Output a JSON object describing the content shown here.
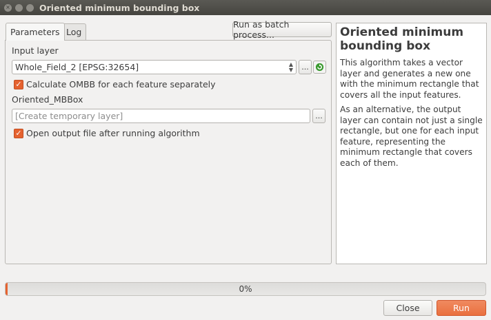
{
  "window": {
    "title": "Oriented minimum bounding box",
    "close_glyph": "×",
    "minimize_glyph": "",
    "maximize_glyph": ""
  },
  "tabs": [
    {
      "label": "Parameters",
      "active": true
    },
    {
      "label": "Log",
      "active": false
    }
  ],
  "toolbar": {
    "batch_label": "Run as batch process..."
  },
  "params": {
    "input_layer_label": "Input layer",
    "input_layer_value": "Whole_Field_2 [EPSG:32654]",
    "browse_label": "...",
    "calc_checkbox_label": "Calculate OMBB for each feature separately",
    "calc_checked": true,
    "output_label": "Oriented_MBBox",
    "output_placeholder": "[Create temporary layer]",
    "output_browse_label": "...",
    "open_checkbox_label": "Open output file after running algorithm",
    "open_checked": true
  },
  "help": {
    "title": "Oriented minimum bounding box",
    "paragraphs": [
      "This algorithm takes a vector layer and generates a new one with the minimum rectangle that covers all the input features.",
      "As an alternative, the output layer can contain not just a single rectangle, but one for each input feature, representing the minimum rectangle that covers each of them."
    ]
  },
  "progress": {
    "text": "0%",
    "fraction": 0.004
  },
  "footer": {
    "close_label": "Close",
    "run_label": "Run"
  },
  "icons": {
    "refresh": "refresh-icon",
    "combo": "spin-arrows-icon",
    "check": "checkmark-icon"
  },
  "colors": {
    "accent": "#e5622f",
    "refresh_green": "#3a9a2f"
  }
}
